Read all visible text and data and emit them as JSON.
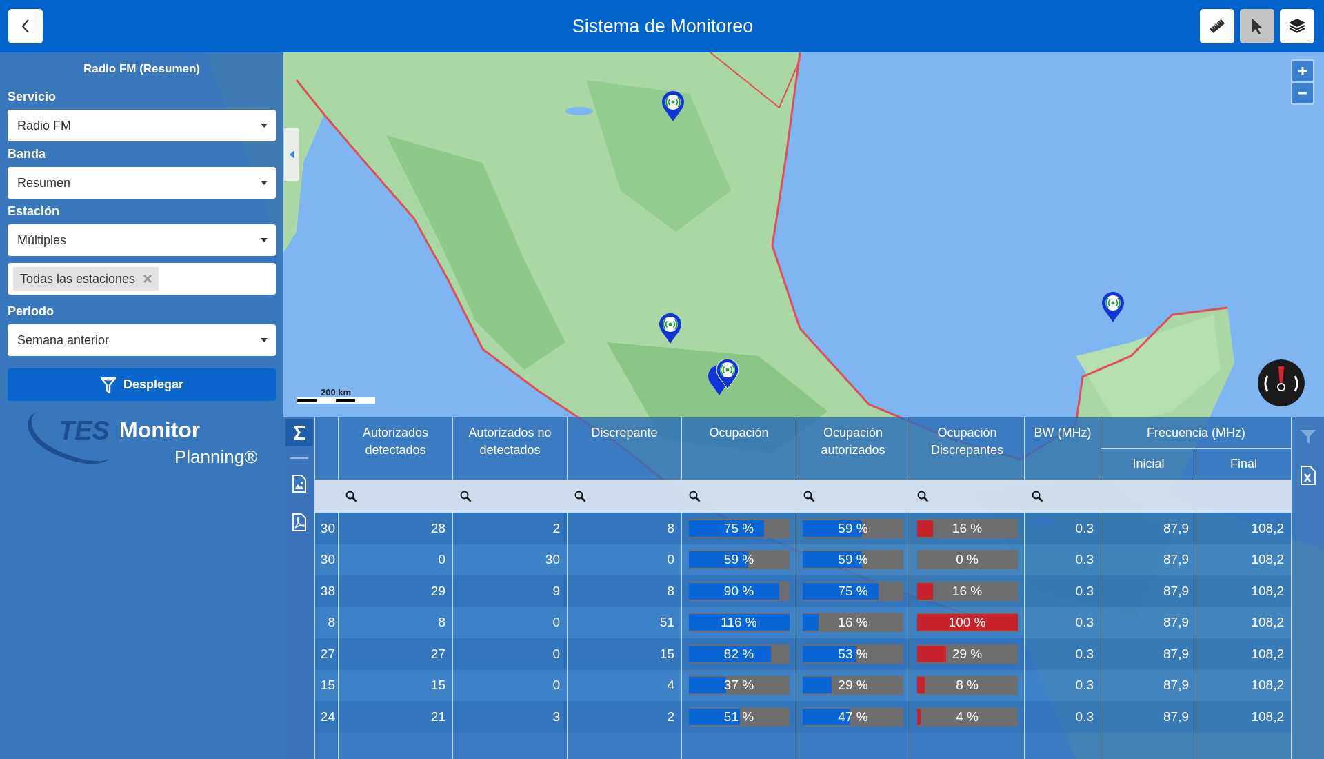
{
  "header": {
    "title": "Sistema de Monitoreo",
    "tools": [
      {
        "kind": "ruler",
        "selected": false
      },
      {
        "kind": "pointer",
        "selected": true
      },
      {
        "kind": "layers",
        "selected": false
      }
    ]
  },
  "sidebar": {
    "title": "Radio FM (Resumen)",
    "fields": [
      {
        "kind": "select",
        "label": "Servicio",
        "value": "Radio FM"
      },
      {
        "kind": "select",
        "label": "Banda",
        "value": "Resumen"
      },
      {
        "kind": "select",
        "label": "Estación",
        "value": "Múltiples"
      },
      {
        "kind": "tags",
        "tags": [
          "Todas las estaciones"
        ]
      },
      {
        "kind": "select",
        "label": "Periodo",
        "value": "Semana anterior"
      }
    ],
    "button": "Desplegar",
    "logo": {
      "brand": "TES",
      "product": "Monitor",
      "edition": "Planning®"
    }
  },
  "map": {
    "scale": "200 km"
  },
  "table": {
    "side_tools": [
      {
        "kind": "summary",
        "selected": true
      },
      {
        "kind": "image_export",
        "selected": false
      },
      {
        "kind": "pdf_export",
        "selected": false
      }
    ],
    "right_tools": [
      {
        "kind": "filter",
        "disabled": true
      },
      {
        "kind": "excel",
        "disabled": false
      }
    ],
    "group_header": "Frecuencia (MHz)",
    "columns": [
      {
        "kind": "number"
      },
      {
        "kind": "number",
        "label": "Autorizados detectados",
        "searchable": true,
        "grouped": false
      },
      {
        "kind": "number",
        "label": "Autorizados no detectados",
        "searchable": true,
        "grouped": false
      },
      {
        "kind": "number",
        "label": "Discrepante",
        "searchable": true,
        "grouped": false
      },
      {
        "kind": "bar",
        "label": "Ocupación",
        "searchable": true,
        "grouped": false,
        "color": "#0a66d6"
      },
      {
        "kind": "bar",
        "label": "Ocupación autorizados",
        "searchable": true,
        "grouped": false,
        "color": "#0a66d6"
      },
      {
        "kind": "bar",
        "label": "Ocupación Discrepantes",
        "searchable": true,
        "grouped": false,
        "color": "#c8222a"
      },
      {
        "kind": "number",
        "label": "BW (MHz)",
        "searchable": true,
        "grouped": false
      },
      {
        "kind": "number",
        "grouped": true,
        "label": "Inicial",
        "searchable": false
      },
      {
        "kind": "number",
        "grouped": true,
        "label": "Final",
        "searchable": false
      }
    ],
    "rows": [
      {
        "cells": [
          "30",
          "28",
          "2",
          "8",
          {
            "text": "75 %",
            "level": 0.75
          },
          {
            "text": "59 %",
            "level": 0.59
          },
          {
            "text": "16 %",
            "level": 0.16
          },
          "0.3",
          "87,9",
          "108,2"
        ]
      },
      {
        "cells": [
          "30",
          "0",
          "30",
          "0",
          {
            "text": "59 %",
            "level": 0.59
          },
          {
            "text": "59 %",
            "level": 0.59
          },
          {
            "text": "0 %",
            "level": 0
          },
          "0.3",
          "87,9",
          "108,2"
        ]
      },
      {
        "cells": [
          "38",
          "29",
          "9",
          "8",
          {
            "text": "90 %",
            "level": 0.9
          },
          {
            "text": "75 %",
            "level": 0.75
          },
          {
            "text": "16 %",
            "level": 0.16
          },
          "0.3",
          "87,9",
          "108,2"
        ]
      },
      {
        "cells": [
          "8",
          "8",
          "0",
          "51",
          {
            "text": "116 %",
            "level": 1
          },
          {
            "text": "16 %",
            "level": 0.16
          },
          {
            "text": "100 %",
            "level": 1
          },
          "0.3",
          "87,9",
          "108,2"
        ]
      },
      {
        "cells": [
          "27",
          "27",
          "0",
          "15",
          {
            "text": "82 %",
            "level": 0.82
          },
          {
            "text": "53 %",
            "level": 0.53
          },
          {
            "text": "29 %",
            "level": 0.29
          },
          "0.3",
          "87,9",
          "108,2"
        ]
      },
      {
        "cells": [
          "15",
          "15",
          "0",
          "4",
          {
            "text": "37 %",
            "level": 0.37
          },
          {
            "text": "29 %",
            "level": 0.29
          },
          {
            "text": "8 %",
            "level": 0.08
          },
          "0.3",
          "87,9",
          "108,2"
        ]
      },
      {
        "cells": [
          "24",
          "21",
          "3",
          "2",
          {
            "text": "51 %",
            "level": 0.51
          },
          {
            "text": "47 %",
            "level": 0.47
          },
          {
            "text": "4 %",
            "level": 0.04
          },
          "0.3",
          "87,9",
          "108,2"
        ]
      }
    ]
  }
}
